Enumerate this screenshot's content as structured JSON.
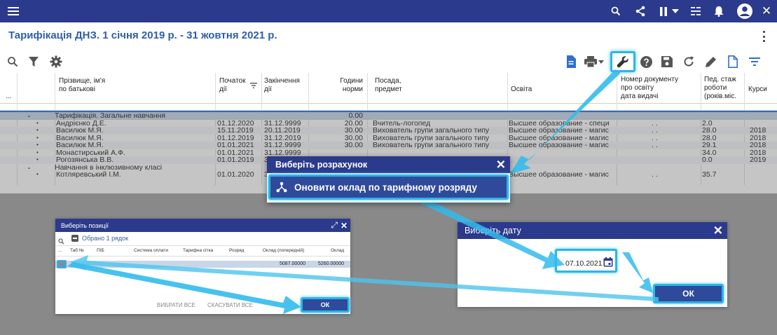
{
  "page": {
    "title": "Тарифікація ДНЗ. 1 січня 2019 р. - 31 жовтня 2021 р."
  },
  "topbar": {
    "icons": [
      "menu-icon",
      "search-icon",
      "share-icon",
      "pause-icon",
      "chevron-down-icon",
      "list-check-icon",
      "bell-icon",
      "account-icon",
      "close-icon"
    ]
  },
  "toolbar": {
    "left_icons": [
      "search-icon",
      "filter-icon",
      "gear-icon"
    ],
    "right_icons": [
      "document-icon",
      "print-icon",
      "chevron-down-icon",
      "wrench-icon",
      "help-icon",
      "save-icon",
      "refresh-icon",
      "edit-icon",
      "file-icon",
      "sort-icon"
    ]
  },
  "table": {
    "more_label": "...",
    "columns": {
      "name": "Прізвище, ім'я\nпо батькові",
      "start": "Початок\nдії",
      "end": "Закінчення\nдії",
      "hours": "Години\nнорми",
      "position": "Посада,\nпредмет",
      "education": "Освіта",
      "doc": "Номер документу\nпро освіту\nдата видачі",
      "ped": "Пед. стаж\nроботи\n(років.міс.",
      "courses": "Курси"
    },
    "groups": [
      {
        "label": "Тарифікація. Загальне навчання",
        "hours": "0.00",
        "rows": [
          {
            "name": "Андрієнко Д.Е.",
            "start": "01.12.2020",
            "end": "31.12.9999",
            "hours": "20.00",
            "position": "Вчитель-логопед",
            "education": "Высшее образование - специ",
            "doc": ". .",
            "ped": "2.0",
            "courses": ""
          },
          {
            "name": "Василюк М.Я.",
            "start": "15.11.2019",
            "end": "20.11.2019",
            "hours": "30.00",
            "position": "Вихователь групи загального типу",
            "education": "Высшее образование - магис",
            "doc": ". .",
            "ped": "28.0",
            "courses": "2018"
          },
          {
            "name": "Василюк М.Я.",
            "start": "01.12.2019",
            "end": "31.12.2019",
            "hours": "30.00",
            "position": "Вихователь групи загального типу",
            "education": "Высшее образование - магис",
            "doc": ". .",
            "ped": "28.0",
            "courses": "2018"
          },
          {
            "name": "Василюк М.Я.",
            "start": "01.01.2021",
            "end": "31.12.9999",
            "hours": "30.00",
            "position": "Вихователь групи загального типу",
            "education": "Высшее образование - магис",
            "doc": ". .",
            "ped": "29.1",
            "courses": "2018"
          },
          {
            "name": "Монастирський А.Ф.",
            "start": "01.01.2021",
            "end": "31.12.9999",
            "hours": "",
            "position": "",
            "education": "",
            "doc": "",
            "ped": "34.0",
            "courses": "2018"
          },
          {
            "name": "Рогозянська В.В.",
            "start": "01.01.2019",
            "end": "31.12.9999",
            "hours": "",
            "position": "",
            "education": "",
            "doc": "",
            "ped": "0.0",
            "courses": "2019"
          }
        ]
      },
      {
        "label": "Навчання в інклюзивному класі",
        "hours": "",
        "rows": [
          {
            "name": "Котляревський І.М.",
            "start": "01.01.2020",
            "end": "31.12.9999",
            "hours": "",
            "position": "",
            "education": "Высшее образование - магис",
            "doc": ". .",
            "ped": "35.7",
            "courses": ""
          }
        ]
      }
    ]
  },
  "dialog_calc": {
    "title": "Виберіть розрахунок",
    "option": "Оновити оклад по тарифному розряду"
  },
  "dialog_positions": {
    "title": "Виберіть позиції",
    "selected": "Обрано 1 рядок",
    "columns": [
      "...",
      "Таб №",
      "ПІБ",
      "Система оплати",
      "Тарифна сітка",
      "Розряд",
      "Оклад (попередній)",
      "Оклад"
    ],
    "row": {
      "prev_salary": "5087.00000",
      "salary": "5260.00000"
    },
    "select_all": "ВИБРАТИ ВСЕ",
    "cancel_all": "СКАСУВАТИ ВСЕ",
    "ok": "ОК"
  },
  "dialog_date": {
    "title": "Виберіть дату",
    "date": "07.10.2021",
    "ok": "ОК"
  },
  "colors": {
    "topbar": "#2b3a8c",
    "title": "#2f5fa6",
    "highlight": "#2ab6e8",
    "button": "#2f4a9a",
    "group_row": "#c9d6e8"
  }
}
